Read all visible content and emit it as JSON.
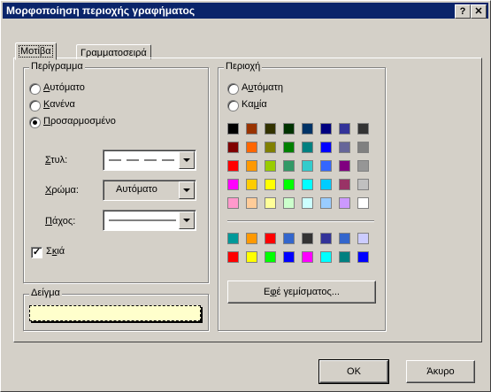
{
  "window": {
    "title": "Μορφοποίηση περιοχής γραφήματος",
    "help_btn": "?",
    "close_btn": "✕"
  },
  "tabs": [
    {
      "label": "Μοτίβα"
    },
    {
      "label": "Γραμματοσειρά"
    }
  ],
  "border_group": {
    "legend": "Περίγραμμα",
    "options": [
      {
        "label_u": "Α",
        "label_rest": "υτόματο",
        "selected": false
      },
      {
        "label_u": "Κ",
        "label_rest": "ανένα",
        "selected": false
      },
      {
        "label_u": "Π",
        "label_rest": "ροσαρμοσμένο",
        "selected": true
      }
    ],
    "style": {
      "label_u": "Σ",
      "label_rest": "τυλ:"
    },
    "color": {
      "label_u": "Χ",
      "label_rest": "ρώμα:",
      "value": "Αυτόματο"
    },
    "weight": {
      "label_u": "Π",
      "label_rest": "άχος:"
    },
    "shadow": {
      "label_pre": "Σ",
      "label_u": "κ",
      "label_rest": "ιά",
      "checked": true
    }
  },
  "sample_group": {
    "legend": "Δείγμα",
    "fill": "#ffffcc"
  },
  "area_group": {
    "legend": "Περιοχή",
    "options": [
      {
        "label_pre": "Α",
        "label_u": "υ",
        "label_rest": "τόματη",
        "selected": false
      },
      {
        "label_pre": "Κα",
        "label_u": "μ",
        "label_rest": "ία",
        "selected": false
      }
    ],
    "palette_top": [
      [
        "#000000",
        "#993300",
        "#333300",
        "#003300",
        "#003366",
        "#000080",
        "#333399",
        "#333333"
      ],
      [
        "#800000",
        "#ff6600",
        "#808000",
        "#008000",
        "#008080",
        "#0000ff",
        "#666699",
        "#808080"
      ],
      [
        "#ff0000",
        "#ff9900",
        "#99cc00",
        "#339966",
        "#33cccc",
        "#3366ff",
        "#800080",
        "#969696"
      ],
      [
        "#ff00ff",
        "#ffcc00",
        "#ffff00",
        "#00ff00",
        "#00ffff",
        "#00ccff",
        "#993366",
        "#c0c0c0"
      ],
      [
        "#ff99cc",
        "#ffcc99",
        "#ffff99",
        "#ccffcc",
        "#ccffff",
        "#99ccff",
        "#cc99ff",
        "#ffffff"
      ]
    ],
    "palette_bottom": [
      [
        "#009999",
        "#ff9900",
        "#ff0000",
        "#3366cc",
        "#333333",
        "#333399",
        "#3366cc",
        "#ccccff"
      ],
      [
        "#ff0000",
        "#ffff00",
        "#00ff00",
        "#0000ff",
        "#ff00ff",
        "#00ffff",
        "#008080",
        "#0000ff"
      ]
    ],
    "fill_effects": {
      "label_pre": "Ε",
      "label_u": "φ",
      "label_rest": "έ γεμίσματος..."
    }
  },
  "footer": {
    "ok_label": "OK",
    "cancel_label": "Άκυρο"
  }
}
